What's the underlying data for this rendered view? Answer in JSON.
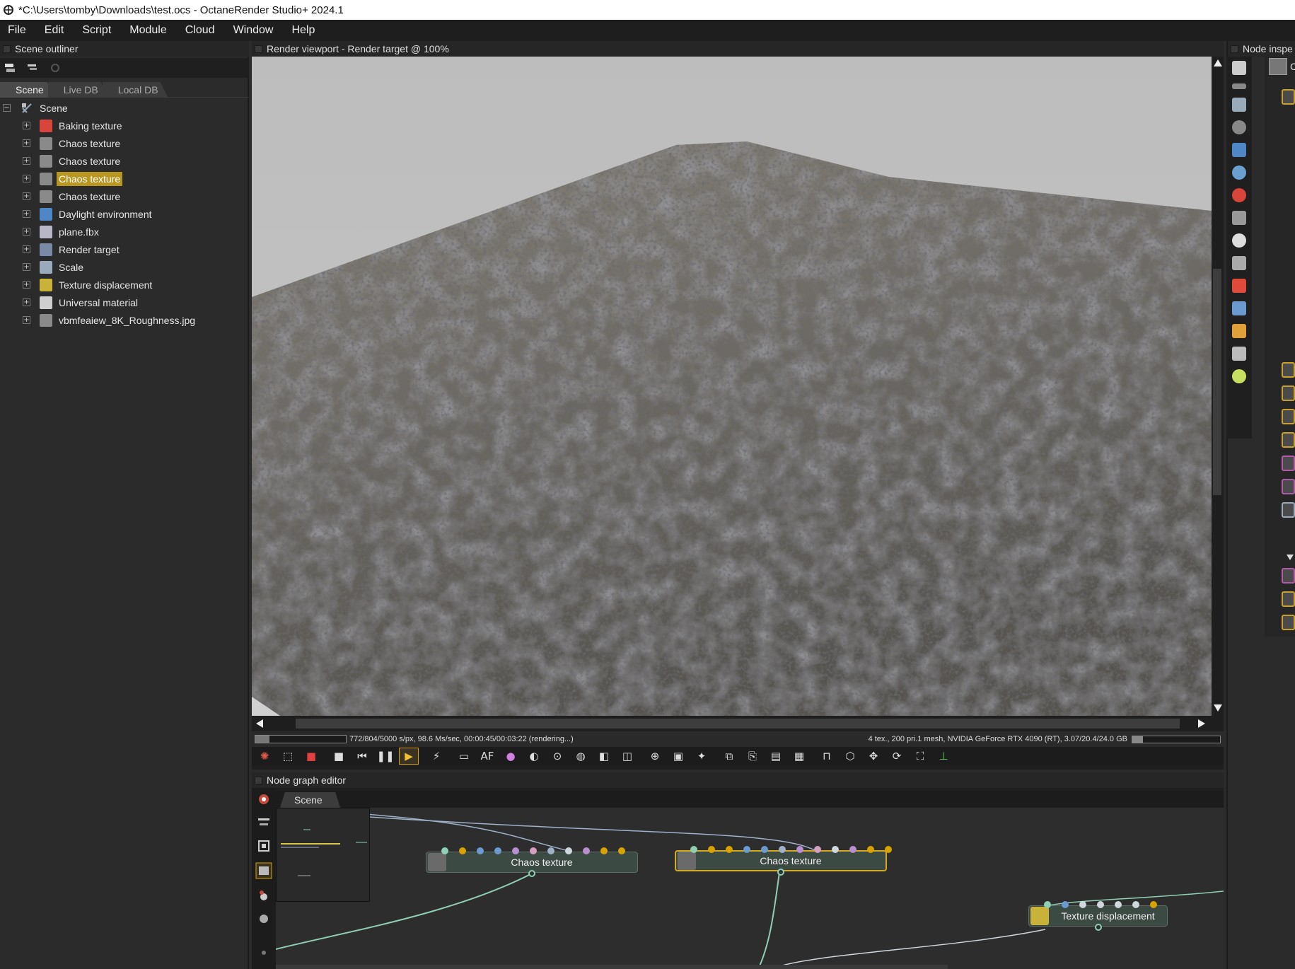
{
  "title_bar": {
    "text": "*C:\\Users\\tomby\\Downloads\\test.ocs - OctaneRender Studio+ 2024.1"
  },
  "menu": [
    "File",
    "Edit",
    "Script",
    "Module",
    "Cloud",
    "Window",
    "Help"
  ],
  "outliner": {
    "title": "Scene outliner",
    "tabs": [
      "Scene",
      "Live DB",
      "Local DB"
    ],
    "root": "Scene",
    "items": [
      {
        "label": "Baking texture",
        "icon": "baking-texture-icon",
        "color": "#d9453a"
      },
      {
        "label": "Chaos texture",
        "icon": "chaos-texture-icon",
        "color": "#8a8a8a"
      },
      {
        "label": "Chaos texture",
        "icon": "chaos-texture-icon",
        "color": "#8a8a8a"
      },
      {
        "label": "Chaos texture",
        "icon": "chaos-texture-icon",
        "color": "#8a8a8a",
        "selected": true
      },
      {
        "label": "Chaos texture",
        "icon": "chaos-texture-icon",
        "color": "#8a8a8a"
      },
      {
        "label": "Daylight environment",
        "icon": "daylight-environment-icon",
        "color": "#4f86c6"
      },
      {
        "label": "plane.fbx",
        "icon": "mesh-icon",
        "color": "#b7b7c8"
      },
      {
        "label": "Render target",
        "icon": "render-target-icon",
        "color": "#7a8aa6"
      },
      {
        "label": "Scale",
        "icon": "scale-icon",
        "color": "#9aa9bb"
      },
      {
        "label": "Texture displacement",
        "icon": "texture-displacement-icon",
        "color": "#c8b23a"
      },
      {
        "label": "Universal material",
        "icon": "material-icon",
        "color": "#cfcfcf"
      },
      {
        "label": "vbmfeaiew_8K_Roughness.jpg",
        "icon": "image-texture-icon",
        "color": "#8a8a8a"
      }
    ]
  },
  "viewport": {
    "title": "Render viewport - Render target @ 100%",
    "status_left": "772/804/5000 s/px, 98.6 Ms/sec, 00:00:45/00:03:22 (rendering...)",
    "status_right": "4 tex., 200 pri.1 mesh, NVIDIA GeForce RTX 4090 (RT), 3.07/20.4/24.0 GB",
    "progress": 0.154,
    "toolbar": [
      "octane-logo-icon",
      "region-icon",
      "cube-icon",
      "stop-icon",
      "restart-icon",
      "pause-icon",
      "play-icon",
      "lightning-icon",
      "display-icon",
      "focus-icon",
      "color-icon",
      "white-balance-icon",
      "picker-icon",
      "material-picker-icon",
      "object-picker-icon",
      "camera-picker-icon",
      "zoom-icon",
      "film-icon",
      "lens-icon",
      "copy-icon",
      "paste-icon",
      "save-icon",
      "export-icon",
      "lock-icon",
      "box-icon",
      "move-icon",
      "rotate-icon",
      "fullscreen-icon",
      "axis-icon"
    ]
  },
  "node_graph": {
    "title": "Node graph editor",
    "tab": "Scene",
    "nodes": [
      {
        "label": "Chaos texture",
        "selected": false
      },
      {
        "label": "Chaos texture",
        "selected": true
      },
      {
        "label": "Texture displacement",
        "selected": false
      }
    ]
  },
  "inspector": {
    "title": "Node inspe"
  }
}
